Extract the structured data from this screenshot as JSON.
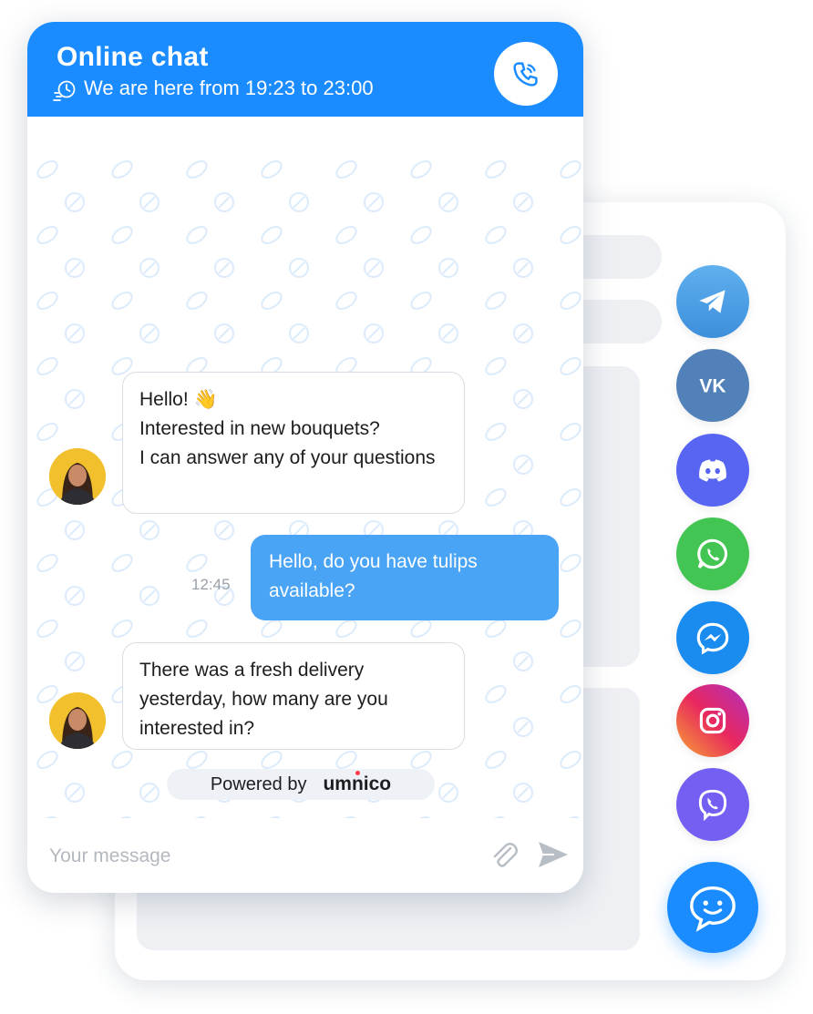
{
  "header": {
    "title": "Online chat",
    "subtitle": "We are here from 19:23 to 23:00",
    "accent_color": "#1a8cff"
  },
  "messages": [
    {
      "direction": "incoming",
      "text": "Hello! 👋\nInterested in new bouquets?\nI can answer any of your questions"
    },
    {
      "direction": "outgoing",
      "text": "Hello, do you have tulips\navailable?",
      "time": "12:45"
    },
    {
      "direction": "incoming",
      "text": "There was a fresh delivery\nyesterday, how many are you\ninterested in?"
    }
  ],
  "footer": {
    "powered_label": "Powered by",
    "brand": "umnico"
  },
  "input": {
    "placeholder": "Your message"
  },
  "messengers": [
    {
      "name": "telegram-icon",
      "color": "#4a9fe8"
    },
    {
      "name": "vk-icon",
      "color": "#5181b8"
    },
    {
      "name": "discord-icon",
      "color": "#5865f2"
    },
    {
      "name": "whatsapp-icon",
      "color": "#43c553"
    },
    {
      "name": "messenger-icon",
      "color": "#1a8cf0"
    },
    {
      "name": "instagram-icon",
      "color": "#e1306c"
    },
    {
      "name": "viber-icon",
      "color": "#7360f2"
    }
  ]
}
